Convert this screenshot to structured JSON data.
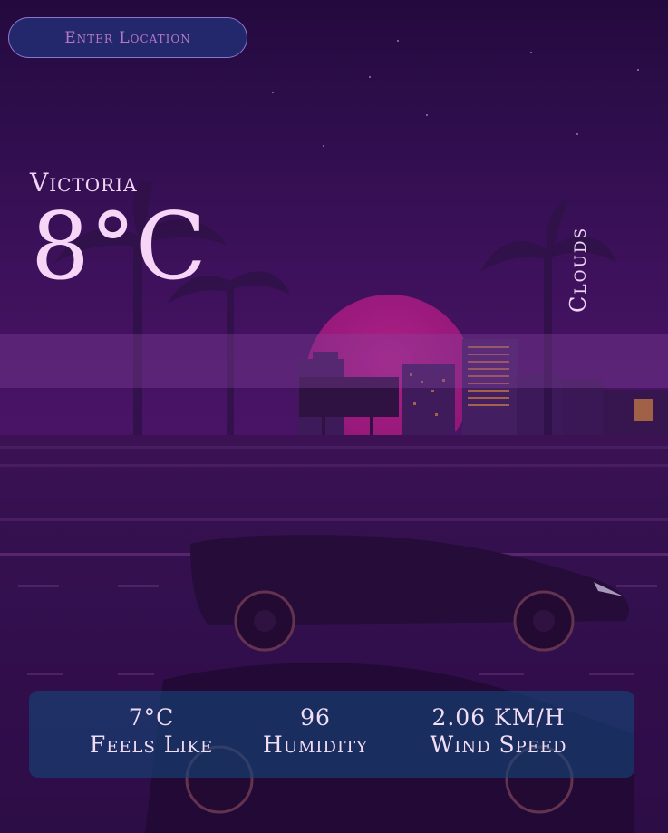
{
  "search": {
    "placeholder": "Enter Location"
  },
  "weather": {
    "city": "Victoria",
    "temperature": "8°C",
    "condition": "Clouds"
  },
  "stats": {
    "feels_like": {
      "value": "7°C",
      "label": "Feels Like"
    },
    "humidity": {
      "value": "96",
      "label": "Humidity"
    },
    "wind_speed": {
      "value": "2.06 KM/H",
      "label": "Wind Speed"
    }
  },
  "colors": {
    "background": "#2a0a3f",
    "sun": "#b01e80",
    "input_bg": "#223078",
    "input_border": "#8b74c9",
    "text": "#f2ddf5",
    "panel": "#144678"
  }
}
